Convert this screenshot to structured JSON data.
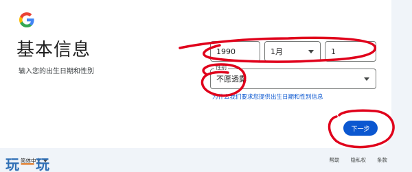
{
  "header": {
    "title": "基本信息",
    "subtitle": "输入您的出生日期和性别"
  },
  "birthdate": {
    "year_value": "1990",
    "month_value": "1月",
    "day_value": "1"
  },
  "gender": {
    "label": "性别",
    "value": "不愿透露"
  },
  "help_link": "为什么我们要求您提供出生日期和性别信息",
  "next_button": "下一步",
  "footer": {
    "language": "简体中文",
    "links": [
      "帮助",
      "隐私权",
      "条款"
    ]
  },
  "watermark": {
    "part1": "玩",
    "dash": "一",
    "part2": "玩"
  },
  "colors": {
    "accent": "#0b57d0",
    "annotation": "#e0001b",
    "background": "#f0f4f9"
  },
  "icons": {
    "logo": "google-g-logo",
    "select_caret": "caret-down-icon"
  }
}
